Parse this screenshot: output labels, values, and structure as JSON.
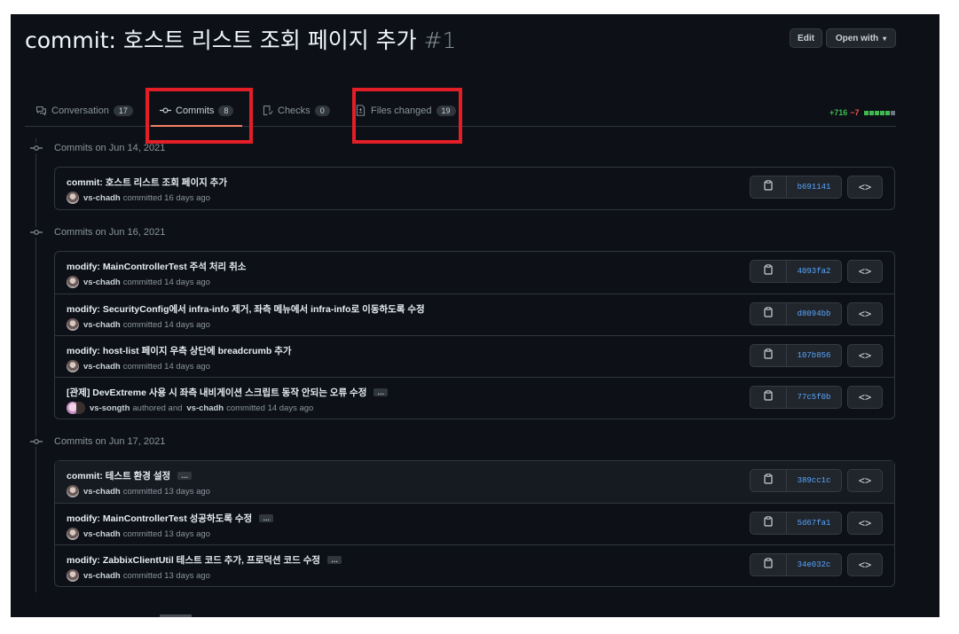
{
  "pr": {
    "title": "commit: 호스트 리스트 조회 페이지 추가",
    "number": "#1"
  },
  "header": {
    "edit_label": "Edit",
    "open_with_label": "Open with"
  },
  "tabs": [
    {
      "label": "Conversation",
      "count": "17",
      "icon": "comment-icon"
    },
    {
      "label": "Commits",
      "count": "8",
      "icon": "git-commit-icon"
    },
    {
      "label": "Checks",
      "count": "0",
      "icon": "checklist-icon"
    },
    {
      "label": "Files changed",
      "count": "19",
      "icon": "file-diff-icon"
    }
  ],
  "diffstat": {
    "additions": "+716",
    "deletions": "−7",
    "colors": {
      "add": "#3fb950",
      "neutral": "#6e7681"
    }
  },
  "groups": [
    {
      "heading": "Commits on Jun 14, 2021",
      "commits": [
        {
          "message": "commit: 호스트 리스트 조회 페이지 추가",
          "author": "vs-chadh",
          "action": "committed 16 days ago",
          "sha": "b691141",
          "ellipsis": false,
          "shaded": false
        }
      ]
    },
    {
      "heading": "Commits on Jun 16, 2021",
      "commits": [
        {
          "message": "modify: MainControllerTest 주석 처리 취소",
          "author": "vs-chadh",
          "action": "committed 14 days ago",
          "sha": "4093fa2",
          "ellipsis": false,
          "shaded": false
        },
        {
          "message": "modify: SecurityConfig에서 infra-info 제거, 좌측 메뉴에서 infra-info로 이동하도록 수정",
          "author": "vs-chadh",
          "action": "committed 14 days ago",
          "sha": "d8094bb",
          "ellipsis": false,
          "shaded": false
        },
        {
          "message": "modify: host-list 페이지 우측 상단에 breadcrumb 추가",
          "author": "vs-chadh",
          "action": "committed 14 days ago",
          "sha": "107b856",
          "ellipsis": false,
          "shaded": false
        },
        {
          "message": "[관제] DevExtreme 사용 시 좌측 내비게이션 스크립트 동작 안되는 오류 수정",
          "author": "vs-songth",
          "action": "authored and",
          "coauthor": "vs-chadh",
          "coaction": "committed 14 days ago",
          "sha": "77c5f0b",
          "ellipsis": true,
          "shaded": false
        }
      ]
    },
    {
      "heading": "Commits on Jun 17, 2021",
      "commits": [
        {
          "message": "commit: 테스트 환경 설정",
          "author": "vs-chadh",
          "action": "committed 13 days ago",
          "sha": "389cc1c",
          "ellipsis": true,
          "shaded": true
        },
        {
          "message": "modify: MainControllerTest 성공하도록 수정",
          "author": "vs-chadh",
          "action": "committed 13 days ago",
          "sha": "5d67fa1",
          "ellipsis": true,
          "shaded": false
        },
        {
          "message": "modify: ZabbixClientUtil 테스트 코드 추가, 프로덕션 코드 수정",
          "author": "vs-chadh",
          "action": "committed 13 days ago",
          "sha": "34e032c",
          "ellipsis": true,
          "shaded": false
        }
      ]
    }
  ],
  "ui": {
    "ellipsis": "…",
    "browse_symbol": "<>",
    "caret": "▾"
  },
  "colors": {
    "highlight": "#e41e26",
    "background": "#0d1117",
    "link": "#58a6ff"
  }
}
